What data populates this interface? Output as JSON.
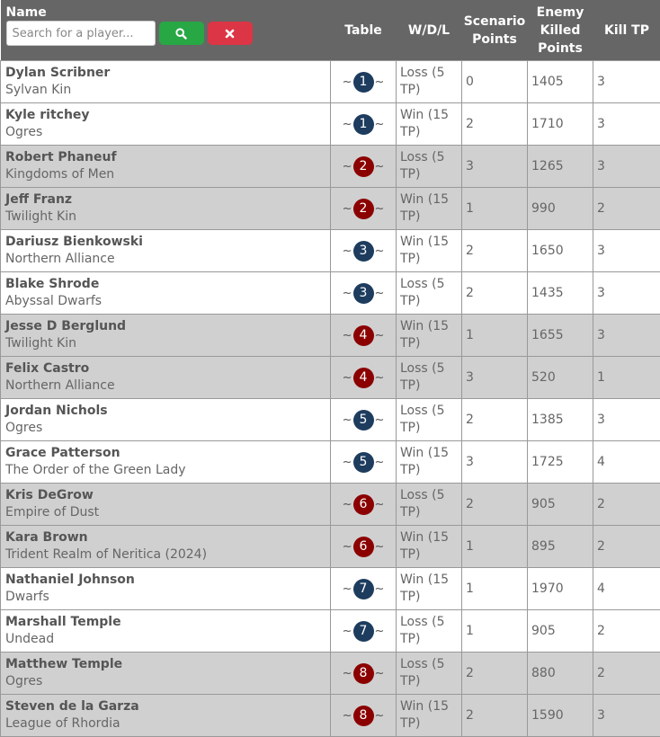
{
  "header": {
    "name": "Name",
    "table": "Table",
    "wdl": "W/D/L",
    "scenario": "Scenario Points",
    "enemy": "Enemy Killed Points",
    "kill_tp": "Kill TP"
  },
  "search": {
    "placeholder": "Search for a player...",
    "value": "",
    "search_icon": "search-icon",
    "clear_icon": "close-icon"
  },
  "colors": {
    "blue_badge": "#1d3c5e",
    "red_badge": "#8b0000",
    "search_btn": "#28a745",
    "clear_btn": "#dc3545"
  },
  "rows": [
    {
      "name": "Dylan Scribner",
      "faction": "Sylvan Kin",
      "table": "1",
      "result": "Loss (5 TP)",
      "scenario": "0",
      "enemy": "1405",
      "kill": "3"
    },
    {
      "name": "Kyle ritchey",
      "faction": "Ogres",
      "table": "1",
      "result": "Win (15 TP)",
      "scenario": "2",
      "enemy": "1710",
      "kill": "3"
    },
    {
      "name": "Robert Phaneuf",
      "faction": "Kingdoms of Men",
      "table": "2",
      "result": "Loss (5 TP)",
      "scenario": "3",
      "enemy": "1265",
      "kill": "3"
    },
    {
      "name": "Jeff Franz",
      "faction": "Twilight Kin",
      "table": "2",
      "result": "Win (15 TP)",
      "scenario": "1",
      "enemy": "990",
      "kill": "2"
    },
    {
      "name": "Dariusz Bienkowski",
      "faction": "Northern Alliance",
      "table": "3",
      "result": "Win (15 TP)",
      "scenario": "2",
      "enemy": "1650",
      "kill": "3"
    },
    {
      "name": "Blake Shrode",
      "faction": "Abyssal Dwarfs",
      "table": "3",
      "result": "Loss (5 TP)",
      "scenario": "2",
      "enemy": "1435",
      "kill": "3"
    },
    {
      "name": "Jesse D Berglund",
      "faction": "Twilight Kin",
      "table": "4",
      "result": "Win (15 TP)",
      "scenario": "1",
      "enemy": "1655",
      "kill": "3"
    },
    {
      "name": "Felix Castro",
      "faction": "Northern Alliance",
      "table": "4",
      "result": "Loss (5 TP)",
      "scenario": "3",
      "enemy": "520",
      "kill": "1"
    },
    {
      "name": "Jordan Nichols",
      "faction": "Ogres",
      "table": "5",
      "result": "Loss (5 TP)",
      "scenario": "2",
      "enemy": "1385",
      "kill": "3"
    },
    {
      "name": "Grace Patterson",
      "faction": "The Order of the Green Lady",
      "table": "5",
      "result": "Win (15 TP)",
      "scenario": "3",
      "enemy": "1725",
      "kill": "4"
    },
    {
      "name": "Kris DeGrow",
      "faction": "Empire of Dust",
      "table": "6",
      "result": "Loss (5 TP)",
      "scenario": "2",
      "enemy": "905",
      "kill": "2"
    },
    {
      "name": "Kara Brown",
      "faction": "Trident Realm of Neritica (2024)",
      "table": "6",
      "result": "Win (15 TP)",
      "scenario": "1",
      "enemy": "895",
      "kill": "2"
    },
    {
      "name": "Nathaniel Johnson",
      "faction": "Dwarfs",
      "table": "7",
      "result": "Win (15 TP)",
      "scenario": "1",
      "enemy": "1970",
      "kill": "4"
    },
    {
      "name": "Marshall Temple",
      "faction": "Undead",
      "table": "7",
      "result": "Loss (5 TP)",
      "scenario": "1",
      "enemy": "905",
      "kill": "2"
    },
    {
      "name": "Matthew Temple",
      "faction": "Ogres",
      "table": "8",
      "result": "Loss (5 TP)",
      "scenario": "2",
      "enemy": "880",
      "kill": "2"
    },
    {
      "name": "Steven de la Garza",
      "faction": "League of Rhordia",
      "table": "8",
      "result": "Win (15 TP)",
      "scenario": "2",
      "enemy": "1590",
      "kill": "3"
    }
  ]
}
